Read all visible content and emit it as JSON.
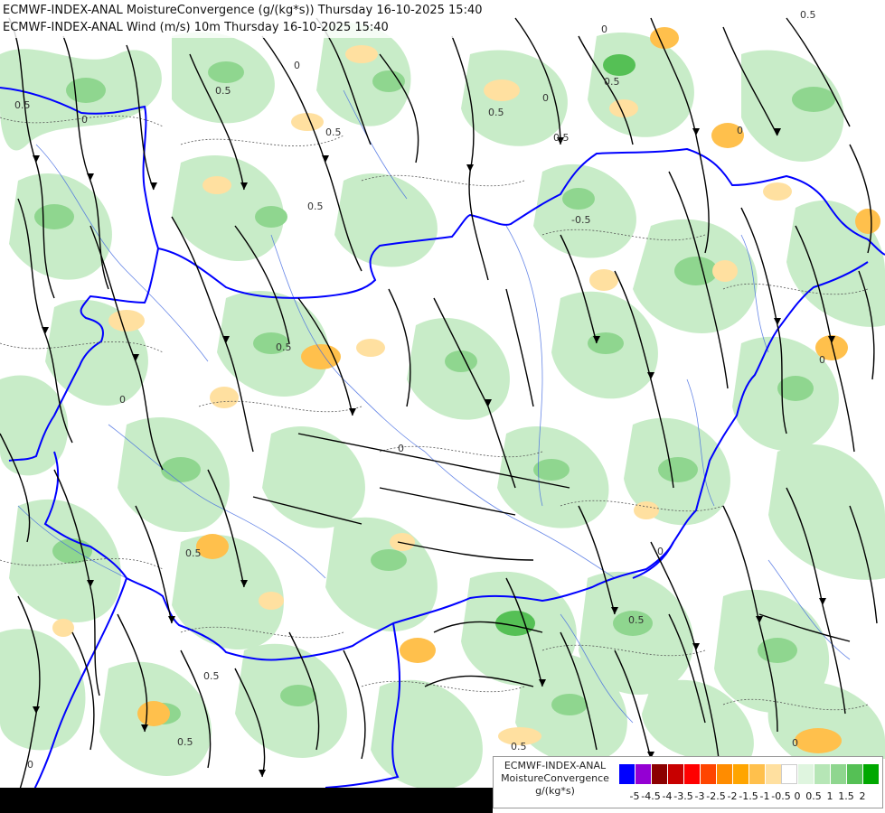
{
  "header": {
    "line1": "ECMWF-INDEX-ANAL MoistureConvergence (g/(kg*s)) Thursday 16-10-2025 15:40",
    "line2": "ECMWF-INDEX-ANAL Wind (m/s) 10m Thursday 16-10-2025 15:40"
  },
  "legend": {
    "title_line1": "ECMWF-INDEX-ANAL",
    "title_line2": "MoistureConvergence",
    "title_line3": "g/(kg*s)",
    "colors": [
      "#0000ff",
      "#9400d3",
      "#8b0000",
      "#c80000",
      "#ff0000",
      "#ff4500",
      "#ff8c00",
      "#ffa500",
      "#ffc04c",
      "#ffe0a0",
      "#ffffff",
      "#dff5df",
      "#b6e6b6",
      "#8fd68f",
      "#55c055",
      "#00a800"
    ],
    "ticks": [
      "-5",
      "-4.5",
      "-4",
      "-3.5",
      "-3",
      "-2.5",
      "-2",
      "-1.5",
      "-1",
      "-0.5",
      "0",
      "0.5",
      "1",
      "1.5",
      "2"
    ]
  },
  "map": {
    "contour_labels": [
      "0.5",
      "0",
      "0.5",
      "0.5",
      "0",
      "0.5",
      "0",
      "0.5",
      "0",
      "0.5",
      "0",
      "0.5",
      "0.5",
      "0",
      "0.5",
      "0",
      "0.5",
      "0",
      "0.5",
      "0",
      "0.5",
      "0.5",
      "-0.5",
      "0",
      "0.5",
      "0"
    ],
    "colors": {
      "water": "#ffffff",
      "conv_weak": "#c8ecc8",
      "conv_mid": "#8fd68f",
      "conv_strong": "#55c055",
      "div_weak": "#ffe0a0",
      "div_mid": "#ffc04c",
      "border": "#0000ff",
      "river": "#4169e1",
      "streamline": "#000000"
    }
  }
}
